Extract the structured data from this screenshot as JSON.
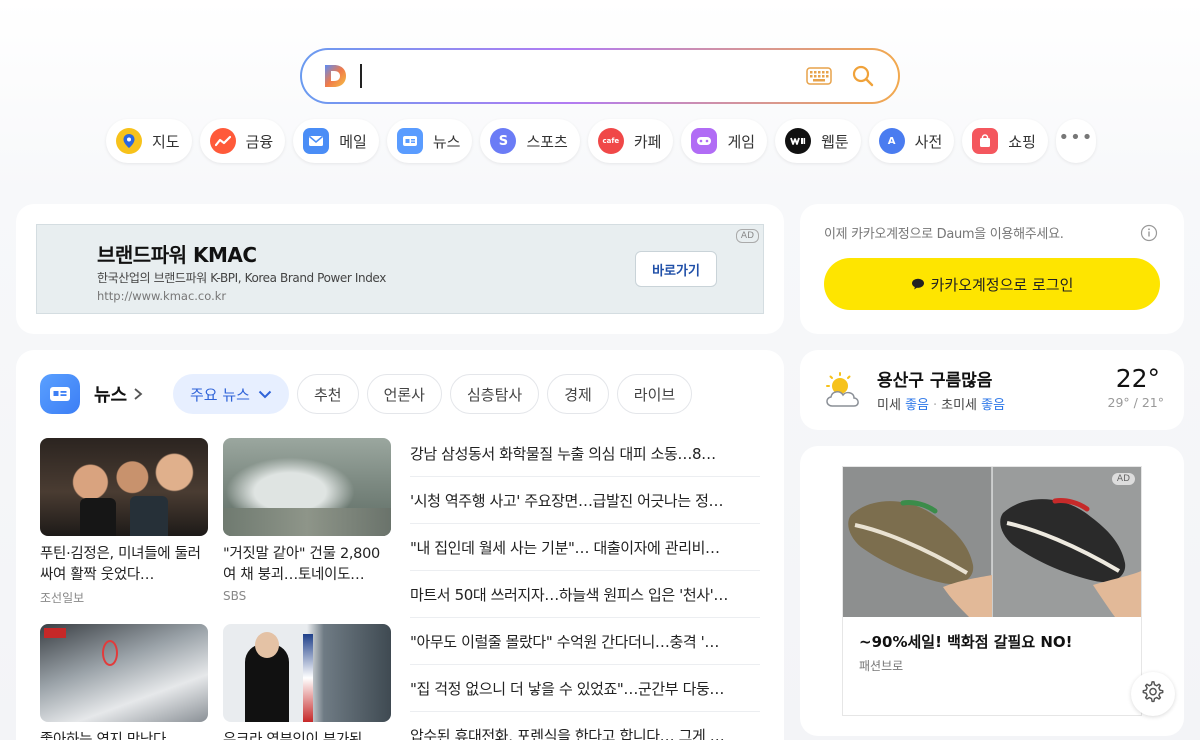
{
  "search": {
    "placeholder": "",
    "value": ""
  },
  "services": [
    {
      "label": "지도",
      "icon": "map-pin-icon",
      "color": "#f7c21b"
    },
    {
      "label": "금융",
      "icon": "finance-chart-icon",
      "color": "#ff5a3a"
    },
    {
      "label": "메일",
      "icon": "mail-icon",
      "color": "#4a8df6"
    },
    {
      "label": "뉴스",
      "icon": "news-icon",
      "color": "#5a9cff"
    },
    {
      "label": "스포츠",
      "icon": "sports-icon",
      "color": "#6b7cf6"
    },
    {
      "label": "카페",
      "icon": "cafe-icon",
      "color": "#f04848"
    },
    {
      "label": "게임",
      "icon": "game-controller-icon",
      "color": "#b16cf5"
    },
    {
      "label": "웹툰",
      "icon": "webtoon-icon",
      "color": "#111111"
    },
    {
      "label": "사전",
      "icon": "dictionary-icon",
      "color": "#4a7cf0"
    },
    {
      "label": "쇼핑",
      "icon": "shopping-bag-icon",
      "color": "#f4575e"
    }
  ],
  "ad": {
    "title": "브랜드파워 KMAC",
    "desc": "한국산업의 브랜드파워 K-BPI, Korea Brand Power Index",
    "url": "http://www.kmac.co.kr",
    "button": "바로가기",
    "mark": "AD"
  },
  "login": {
    "prompt": "이제 카카오계정으로 Daum을 이용해주세요.",
    "button": "카카오계정으로 로그인"
  },
  "news": {
    "title": "뉴스",
    "tabs": [
      "주요 뉴스",
      "추천",
      "언론사",
      "심층탐사",
      "경제",
      "라이브"
    ],
    "thumbs": [
      {
        "title": "푸틴·김정은, 미녀들에 둘러싸여 활짝 웃었다…",
        "source": "조선일보"
      },
      {
        "title": "\"거짓말 같아\" 건물 2,800여 채 붕괴…토네이도…",
        "source": "SBS"
      },
      {
        "title": "좋아하는 연지 만난다…",
        "source": ""
      },
      {
        "title": "우크라 영부인이 부가된…",
        "source": ""
      }
    ],
    "headlines": [
      "강남 삼성동서 화학물질 누출 의심 대피 소동…8…",
      "'시청 역주행 사고' 주요장면…급발진 어긋나는 정…",
      "\"내 집인데 월세 사는 기분\"… 대출이자에 관리비…",
      "마트서 50대 쓰러지자…하늘색 원피스 입은 '천사'…",
      "\"아무도 이럴줄 몰랐다\" 수억원 간다더니…충격 '…",
      "\"집 걱정 없으니 더 낳을 수 있었죠\"…군간부 다둥…",
      "압수된 휴대전화, 포렌식을 한다고 합니다… 그게 …"
    ]
  },
  "weather": {
    "location": "용산구 구름많음",
    "fine_dust_label": "미세",
    "fine_dust_value": "좋음",
    "ultrafine_label": "초미세",
    "ultrafine_value": "좋음",
    "temp": "22°",
    "range": "29° / 21°"
  },
  "shop_ad": {
    "title": "~90%세일! 백화점 갈필요 NO!",
    "brand": "패션브로",
    "mark": "AD"
  }
}
